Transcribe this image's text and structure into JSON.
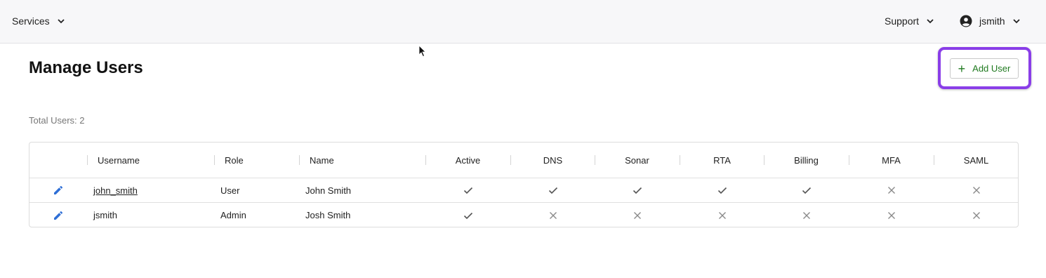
{
  "nav": {
    "services_label": "Services",
    "support_label": "Support",
    "user_label": "jsmith"
  },
  "page": {
    "title": "Manage Users",
    "total_users": "Total Users: 2"
  },
  "actions": {
    "add_user_label": "Add User"
  },
  "table": {
    "columns": [
      "Username",
      "Role",
      "Name",
      "Active",
      "DNS",
      "Sonar",
      "RTA",
      "Billing",
      "MFA",
      "SAML"
    ],
    "rows": [
      {
        "username": "john_smith",
        "role": "User",
        "name": "John Smith",
        "flags": [
          "check",
          "check",
          "check",
          "check",
          "check",
          "cross",
          "cross"
        ]
      },
      {
        "username": "jsmith",
        "role": "Admin",
        "name": "Josh Smith",
        "flags": [
          "check",
          "cross",
          "cross",
          "cross",
          "cross",
          "cross",
          "cross"
        ]
      }
    ]
  },
  "colors": {
    "accent_highlight": "#8a3ee8",
    "add_button_text": "#1f7a1f",
    "edit_icon": "#2f6fd6"
  },
  "icons": {
    "edit": "pencil-icon",
    "check": "check-icon",
    "cross": "close-icon",
    "user": "account-circle-icon",
    "chevron": "chevron-down-icon",
    "plus": "plus-icon"
  }
}
